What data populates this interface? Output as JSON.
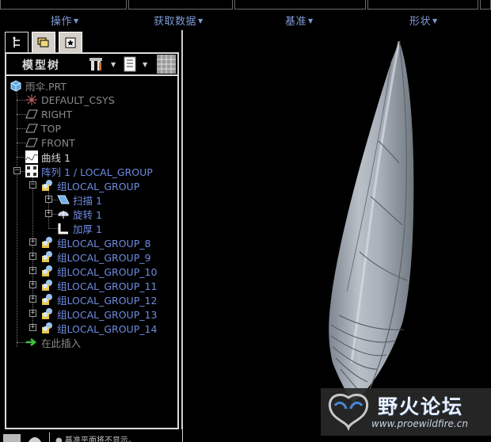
{
  "menubar": {
    "items": [
      {
        "label": "操作"
      },
      {
        "label": "获取数据"
      },
      {
        "label": "基准"
      },
      {
        "label": "形状"
      }
    ]
  },
  "model_tree": {
    "title": "模型树",
    "nodes": [
      {
        "label": "雨伞.PRT",
        "icon": "part-icon"
      },
      {
        "label": "DEFAULT_CSYS",
        "icon": "csys-icon"
      },
      {
        "label": "RIGHT",
        "icon": "datum-plane-icon"
      },
      {
        "label": "TOP",
        "icon": "datum-plane-icon"
      },
      {
        "label": "FRONT",
        "icon": "datum-plane-icon"
      },
      {
        "label": "曲线 1",
        "icon": "curve-icon"
      },
      {
        "label": "阵列 1 / LOCAL_GROUP",
        "icon": "pattern-icon"
      },
      {
        "label": "组LOCAL_GROUP",
        "icon": "group-icon"
      },
      {
        "label": "扫描 1",
        "icon": "sweep-icon"
      },
      {
        "label": "旋转 1",
        "icon": "revolve-icon"
      },
      {
        "label": "加厚 1",
        "icon": "thicken-icon"
      },
      {
        "label": "组LOCAL_GROUP_8",
        "icon": "group-icon"
      },
      {
        "label": "组LOCAL_GROUP_9",
        "icon": "group-icon"
      },
      {
        "label": "组LOCAL_GROUP_10",
        "icon": "group-icon"
      },
      {
        "label": "组LOCAL_GROUP_11",
        "icon": "group-icon"
      },
      {
        "label": "组LOCAL_GROUP_12",
        "icon": "group-icon"
      },
      {
        "label": "组LOCAL_GROUP_13",
        "icon": "group-icon"
      },
      {
        "label": "组LOCAL_GROUP_14",
        "icon": "group-icon"
      },
      {
        "label": "在此插入",
        "icon": "insert-here-icon"
      }
    ]
  },
  "watermark": {
    "title": "野火论坛",
    "url": "www.proewildfire.cn"
  },
  "status": {
    "message": "● 基准平面将不显示。"
  },
  "colors": {
    "menu_text": "#7f9ad6",
    "background": "#000000",
    "panel_border": "#dcdcdc",
    "model_surface": "#a9b0b9"
  }
}
